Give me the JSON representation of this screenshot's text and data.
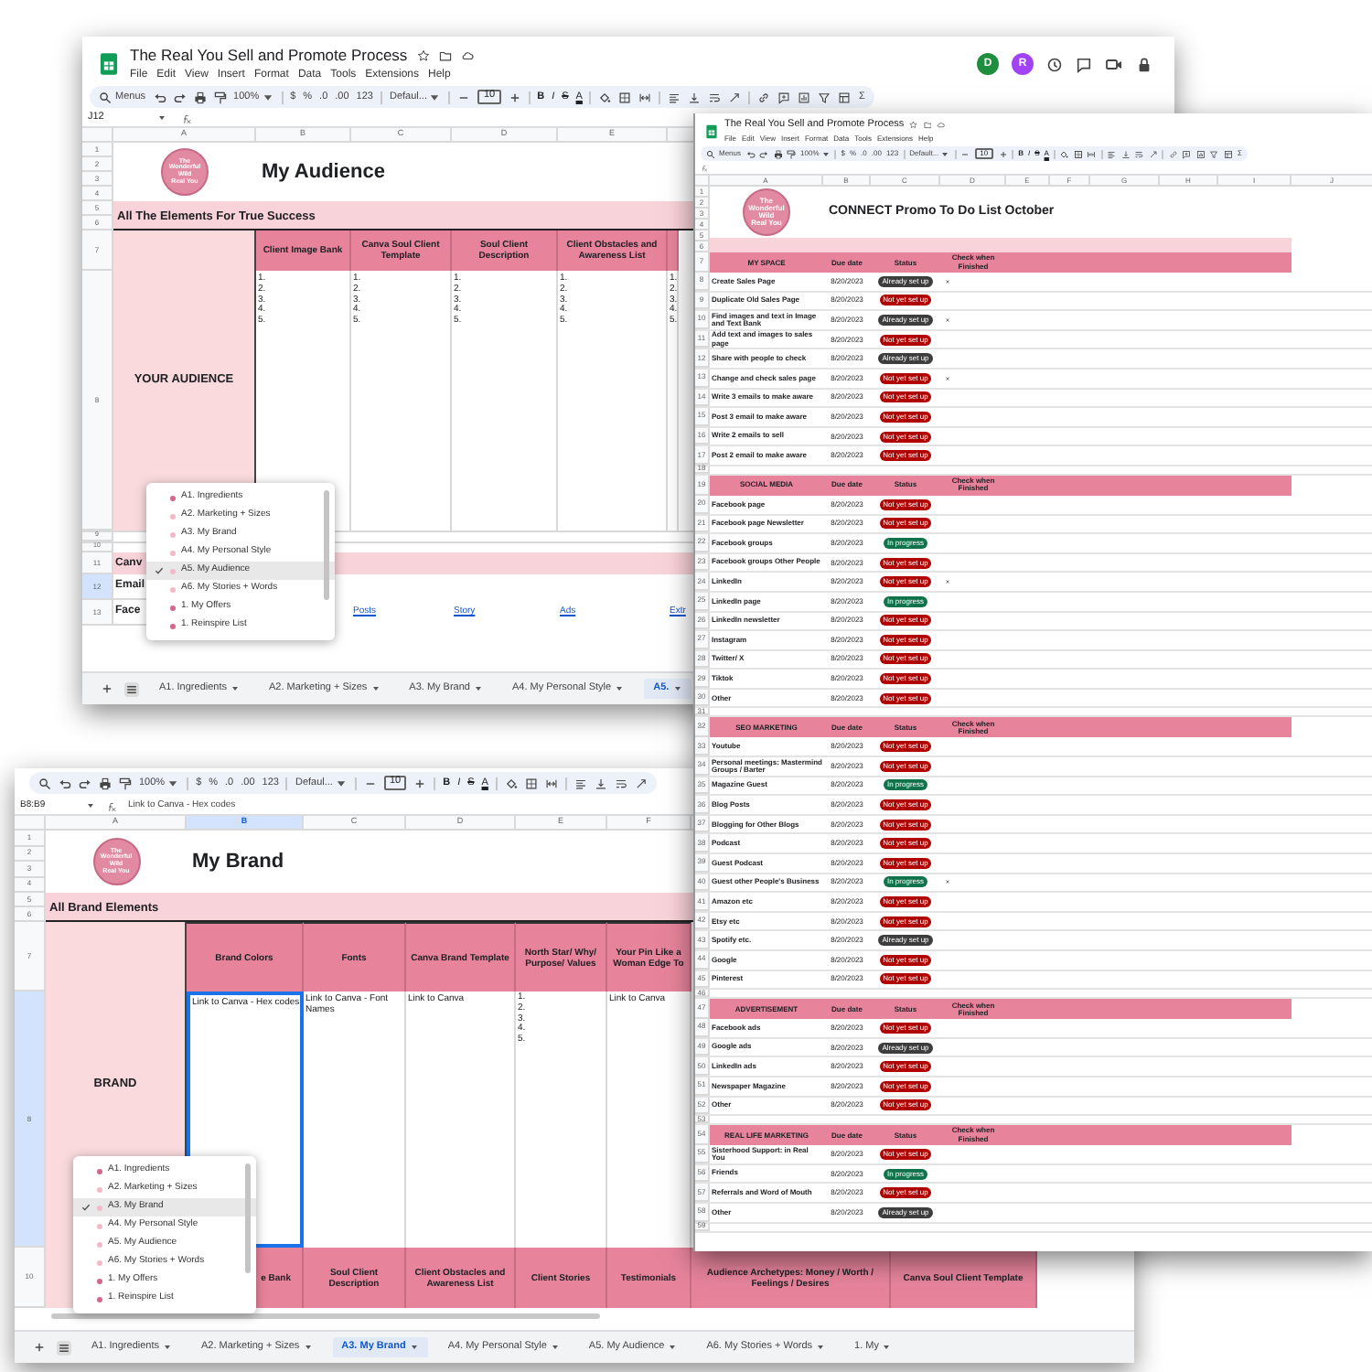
{
  "audience_window": {
    "title": "The Real You Sell and Promote Process",
    "menu": [
      "File",
      "Edit",
      "View",
      "Insert",
      "Format",
      "Data",
      "Tools",
      "Extensions",
      "Help"
    ],
    "avatars": [
      {
        "letter": "D",
        "color": "#1e8e3e"
      },
      {
        "letter": "R",
        "color": "#a142f4"
      }
    ],
    "toolbar": {
      "search": "Menus",
      "zoom": "100%",
      "currency": "$",
      "percent": "%",
      "decrease_decimals": ".0",
      "increase_decimals": ".00",
      "number_format": "123",
      "font": "Defaul...",
      "font_size": "10",
      "bold": "B",
      "italic": "I",
      "strikethrough": "S",
      "text_color": "A",
      "functions": "Σ"
    },
    "cell_ref": "J12",
    "column_letters": [
      "A",
      "B",
      "C",
      "D",
      "E"
    ],
    "top_rows": [
      "1",
      "2",
      "3",
      "4"
    ],
    "logo_lines": [
      "The",
      "Wonderful",
      "Wild",
      "Real You"
    ],
    "heading": "My Audience",
    "band_rows": [
      "5",
      "6"
    ],
    "section_title": "All The Elements For True Success",
    "header_row": "7",
    "body_row": "8",
    "group_label": "YOUR AUDIENCE",
    "columns": [
      {
        "header": "Client Image Bank",
        "items": [
          "1.",
          "2.",
          "3.",
          "4.",
          "5."
        ]
      },
      {
        "header": "Canva Soul Client Template",
        "items": [
          "1.",
          "2.",
          "3.",
          "4.",
          "5."
        ]
      },
      {
        "header": "Soul Client Description",
        "items": [
          "1.",
          "2.",
          "3.",
          "4.",
          "5."
        ]
      },
      {
        "header": "Client Obstacles and Awareness List",
        "items": [
          "1.",
          "2.",
          "3.",
          "4.",
          "5."
        ]
      },
      {
        "items": [
          "1.",
          "2.",
          "3.",
          "4.",
          "5."
        ]
      }
    ],
    "spacer_rows": [
      "9",
      "10"
    ],
    "lower_rows": [
      {
        "row": "11",
        "label": "Canv",
        "kind": "band",
        "selected": false
      },
      {
        "row": "12",
        "label": "Email",
        "kind": "plain",
        "selected": true
      },
      {
        "row": "13",
        "label": "Face",
        "kind": "links",
        "selected": false,
        "links": [
          "Posts",
          "Story",
          "Ads",
          "Extr"
        ]
      }
    ],
    "sheet_menu": [
      {
        "label": "A1. Ingredients",
        "color": "#d6668a",
        "selected": false
      },
      {
        "label": "A2. Marketing + Sizes",
        "color": "#f4b9c9",
        "selected": false
      },
      {
        "label": "A3. My Brand",
        "color": "#f4b9c9",
        "selected": false
      },
      {
        "label": "A4. My Personal Style",
        "color": "#f4b9c9",
        "selected": false
      },
      {
        "label": "A5. My Audience",
        "color": "#f4b9c9",
        "selected": true
      },
      {
        "label": "A6. My Stories + Words",
        "color": "#f4b9c9",
        "selected": false
      },
      {
        "label": "1. My Offers",
        "color": "#d6668a",
        "selected": false
      },
      {
        "label": "1. Reinspire List",
        "color": "#d6668a",
        "selected": false
      }
    ],
    "sheet_tabs": [
      {
        "label": "A1. Ingredients",
        "selected": false
      },
      {
        "label": "A2. Marketing + Sizes",
        "selected": false
      },
      {
        "label": "A3. My Brand",
        "selected": false
      },
      {
        "label": "A4. My Personal Style",
        "selected": false
      },
      {
        "label": "A5.",
        "selected": true
      }
    ]
  },
  "promo_window": {
    "title": "The Real You Sell and Promote Process",
    "menu": [
      "File",
      "Edit",
      "View",
      "Insert",
      "Format",
      "Data",
      "Tools",
      "Extensions",
      "Help"
    ],
    "toolbar": {
      "search": "Menus",
      "zoom": "100%",
      "currency": "$",
      "percent": "%",
      "decrease_decimals": ".0",
      "increase_decimals": ".00",
      "number_format": "123",
      "font": "Default...",
      "font_size": "10",
      "bold": "B",
      "italic": "I",
      "strikethrough": "S",
      "text_color": "A",
      "functions": "Σ"
    },
    "column_letters": [
      "A",
      "B",
      "C",
      "D",
      "E",
      "F",
      "G",
      "H",
      "I",
      "J"
    ],
    "top_rows": [
      "1",
      "2",
      "3",
      "4",
      "5",
      "6"
    ],
    "logo_lines": [
      "The",
      "Wonderful",
      "Wild",
      "Real You"
    ],
    "heading": "CONNECT Promo To Do List October",
    "sections": [
      {
        "row": "7",
        "name": "MY SPACE",
        "due": "Due date",
        "status": "Status",
        "check": "Check when Finished",
        "tasks": [
          {
            "row": "8",
            "task": "Create Sales Page",
            "date": "8/20/2023",
            "status": {
              "label": "Already set up",
              "kind": "done"
            },
            "checked": true
          },
          {
            "row": "9",
            "task": "Duplicate Old Sales Page",
            "date": "8/20/2023",
            "status": {
              "label": "Not yet set up",
              "kind": "todo"
            },
            "checked": false
          },
          {
            "row": "10",
            "task": "Find images and text in Image and Text Bank",
            "date": "8/20/2023",
            "status": {
              "label": "Already set up",
              "kind": "done"
            },
            "checked": true
          },
          {
            "row": "11",
            "task": "Add text and images to sales page",
            "date": "8/20/2023",
            "status": {
              "label": "Not yet set up",
              "kind": "todo"
            },
            "checked": false
          },
          {
            "row": "12",
            "task": "Share with people to check",
            "date": "8/20/2023",
            "status": {
              "label": "Already set up",
              "kind": "done"
            },
            "checked": false
          },
          {
            "row": "13",
            "task": "Change and check sales page",
            "date": "8/20/2023",
            "status": {
              "label": "Not yet set up",
              "kind": "todo"
            },
            "checked": true
          },
          {
            "row": "14",
            "task": "Write 3 emails to make aware",
            "date": "8/20/2023",
            "status": {
              "label": "Not yet set up",
              "kind": "todo"
            },
            "checked": false
          },
          {
            "row": "15",
            "task": "Post 3 email to make aware",
            "date": "8/20/2023",
            "status": {
              "label": "Not yet set up",
              "kind": "todo"
            },
            "checked": false
          },
          {
            "row": "16",
            "task": "Write 2 emails to sell",
            "date": "8/20/2023",
            "status": {
              "label": "Not yet set up",
              "kind": "todo"
            },
            "checked": false
          },
          {
            "row": "17",
            "task": "Post 2 email to make aware",
            "date": "8/20/2023",
            "status": {
              "label": "Not yet set up",
              "kind": "todo"
            },
            "checked": false
          }
        ],
        "gap_row": "18"
      },
      {
        "row": "19",
        "name": "SOCIAL MEDIA",
        "due": "Due date",
        "status": "Status",
        "check": "Check when Finished",
        "tasks": [
          {
            "row": "20",
            "task": "Facebook page",
            "date": "8/20/2023",
            "status": {
              "label": "Not yet set up",
              "kind": "todo"
            },
            "checked": false
          },
          {
            "row": "21",
            "task": "Facebook page Newsletter",
            "date": "8/20/2023",
            "status": {
              "label": "Not yet set up",
              "kind": "todo"
            },
            "checked": false
          },
          {
            "row": "22",
            "task": "Facebook groups",
            "date": "8/20/2023",
            "status": {
              "label": "In progress",
              "kind": "progress"
            },
            "checked": false
          },
          {
            "row": "23",
            "task": "Facebook groups Other People",
            "date": "8/20/2023",
            "status": {
              "label": "Not yet set up",
              "kind": "todo"
            },
            "checked": false
          },
          {
            "row": "24",
            "task": "LinkedIn",
            "date": "8/20/2023",
            "status": {
              "label": "Not yet set up",
              "kind": "todo"
            },
            "checked": true
          },
          {
            "row": "25",
            "task": "LinkedIn page",
            "date": "8/20/2023",
            "status": {
              "label": "In progress",
              "kind": "progress"
            },
            "checked": false
          },
          {
            "row": "26",
            "task": "LinkedIn newsletter",
            "date": "8/20/2023",
            "status": {
              "label": "Not yet set up",
              "kind": "todo"
            },
            "checked": false
          },
          {
            "row": "27",
            "task": "Instagram",
            "date": "8/20/2023",
            "status": {
              "label": "Not yet set up",
              "kind": "todo"
            },
            "checked": false
          },
          {
            "row": "28",
            "task": "Twitter/ X",
            "date": "8/20/2023",
            "status": {
              "label": "Not yet set up",
              "kind": "todo"
            },
            "checked": false
          },
          {
            "row": "29",
            "task": "Tiktok",
            "date": "8/20/2023",
            "status": {
              "label": "Not yet set up",
              "kind": "todo"
            },
            "checked": false
          },
          {
            "row": "30",
            "task": "Other",
            "date": "8/20/2023",
            "status": {
              "label": "Not yet set up",
              "kind": "todo"
            },
            "checked": false
          }
        ],
        "gap_row": "31"
      },
      {
        "row": "32",
        "name": "SEO MARKETING",
        "due": "Due date",
        "status": "Status",
        "check": "Check when Finished",
        "tasks": [
          {
            "row": "33",
            "task": "Youtube",
            "date": "8/20/2023",
            "status": {
              "label": "Not yet set up",
              "kind": "todo"
            },
            "checked": false
          },
          {
            "row": "34",
            "task": "Personal meetings: Mastermind Groups / Barter",
            "date": "8/20/2023",
            "status": {
              "label": "Not yet set up",
              "kind": "todo"
            },
            "checked": false
          },
          {
            "row": "35",
            "task": "Magazine Guest",
            "date": "8/20/2023",
            "status": {
              "label": "In progress",
              "kind": "progress"
            },
            "checked": false
          },
          {
            "row": "36",
            "task": "Blog Posts",
            "date": "8/20/2023",
            "status": {
              "label": "Not yet set up",
              "kind": "todo"
            },
            "checked": false
          },
          {
            "row": "37",
            "task": "Blogging for Other Blogs",
            "date": "8/20/2023",
            "status": {
              "label": "Not yet set up",
              "kind": "todo"
            },
            "checked": false
          },
          {
            "row": "38",
            "task": "Podcast",
            "date": "8/20/2023",
            "status": {
              "label": "Not yet set up",
              "kind": "todo"
            },
            "checked": false
          },
          {
            "row": "39",
            "task": "Guest Podcast",
            "date": "8/20/2023",
            "status": {
              "label": "Not yet set up",
              "kind": "todo"
            },
            "checked": false
          },
          {
            "row": "40",
            "task": "Guest other People's Business",
            "date": "8/20/2023",
            "status": {
              "label": "In progress",
              "kind": "progress"
            },
            "checked": true
          },
          {
            "row": "41",
            "task": "Amazon etc",
            "date": "8/20/2023",
            "status": {
              "label": "Not yet set up",
              "kind": "todo"
            },
            "checked": false
          },
          {
            "row": "42",
            "task": "Etsy etc",
            "date": "8/20/2023",
            "status": {
              "label": "Not yet set up",
              "kind": "todo"
            },
            "checked": false
          },
          {
            "row": "43",
            "task": "Spotify etc.",
            "date": "8/20/2023",
            "status": {
              "label": "Already set up",
              "kind": "done"
            },
            "checked": false
          },
          {
            "row": "44",
            "task": "Google",
            "date": "8/20/2023",
            "status": {
              "label": "Not yet set up",
              "kind": "todo"
            },
            "checked": false
          },
          {
            "row": "45",
            "task": "Pinterest",
            "date": "8/20/2023",
            "status": {
              "label": "Not yet set up",
              "kind": "todo"
            },
            "checked": false
          }
        ],
        "gap_row": "46"
      },
      {
        "row": "47",
        "name": "ADVERTISEMENT",
        "due": "Due date",
        "status": "Status",
        "check": "Check when Finished",
        "tasks": [
          {
            "row": "48",
            "task": "Facebook ads",
            "date": "8/20/2023",
            "status": {
              "label": "Not yet set up",
              "kind": "todo"
            },
            "checked": false
          },
          {
            "row": "49",
            "task": "Google ads",
            "date": "8/20/2023",
            "status": {
              "label": "Already set up",
              "kind": "done"
            },
            "checked": false
          },
          {
            "row": "50",
            "task": "LinkedIn ads",
            "date": "8/20/2023",
            "status": {
              "label": "Not yet set up",
              "kind": "todo"
            },
            "checked": false
          },
          {
            "row": "51",
            "task": "Newspaper Magazine",
            "date": "8/20/2023",
            "status": {
              "label": "Not yet set up",
              "kind": "todo"
            },
            "checked": false
          },
          {
            "row": "52",
            "task": "Other",
            "date": "8/20/2023",
            "status": {
              "label": "Not yet set up",
              "kind": "todo"
            },
            "checked": false
          }
        ],
        "gap_row": "53"
      },
      {
        "row": "54",
        "name": "REAL LIFE MARKETING",
        "due": "Due date",
        "status": "Status",
        "check": "Check when Finished",
        "tasks": [
          {
            "row": "55",
            "task": "Sisterhood Support: in Real You",
            "date": "8/20/2023",
            "status": {
              "label": "Not yet set up",
              "kind": "todo"
            },
            "checked": false
          },
          {
            "row": "56",
            "task": "Friends",
            "date": "8/20/2023",
            "status": {
              "label": "In progress",
              "kind": "progress"
            },
            "checked": false
          },
          {
            "row": "57",
            "task": "Referrals and Word of Mouth",
            "date": "8/20/2023",
            "status": {
              "label": "Not yet set up",
              "kind": "todo"
            },
            "checked": false
          },
          {
            "row": "58",
            "task": "Other",
            "date": "8/20/2023",
            "status": {
              "label": "Already set up",
              "kind": "done"
            },
            "checked": false
          }
        ],
        "gap_row": "59"
      }
    ]
  },
  "brand_window": {
    "toolbar": {
      "zoom": "100%",
      "currency": "$",
      "percent": "%",
      "decrease_decimals": ".0",
      "increase_decimals": ".00",
      "number_format": "123",
      "font": "Defaul...",
      "font_size": "10",
      "bold": "B",
      "italic": "I",
      "strikethrough": "S",
      "text_color": "A"
    },
    "cell_ref": "B8:B9",
    "formula": "Link to Canva - Hex codes",
    "column_letters": [
      {
        "letter": "A",
        "selected": false
      },
      {
        "letter": "B",
        "selected": true
      },
      {
        "letter": "C",
        "selected": false
      },
      {
        "letter": "D",
        "selected": false
      },
      {
        "letter": "E",
        "selected": false
      },
      {
        "letter": "F",
        "selected": false
      }
    ],
    "top_rows": [
      "1",
      "2",
      "3",
      "4"
    ],
    "logo_lines": [
      "The",
      "Wonderful",
      "Wild",
      "Real You"
    ],
    "heading": "My Brand",
    "band_rows": [
      "5",
      "6"
    ],
    "section_title": "All Brand Elements",
    "header_row": "7",
    "body_row": "8",
    "body_selected": true,
    "group_label": "BRAND",
    "columns": [
      {
        "header": "Brand Colors",
        "kind": "text",
        "text": "Link to Canva - Hex codes",
        "selected": true
      },
      {
        "header": "Fonts",
        "kind": "text",
        "text": "Link to Canva - Font Names",
        "selected": false
      },
      {
        "header": "Canva Brand Template",
        "kind": "text",
        "text": "Link to Canva",
        "selected": false
      },
      {
        "header": "North Star/ Why/ Purpose/ Values",
        "kind": "list",
        "items": [
          "1.",
          "2.",
          "3.",
          "4.",
          "5."
        ],
        "selected": false
      },
      {
        "header": "Your Pin Like a Woman Edge To",
        "kind": "text",
        "text": "Link to Canva",
        "selected": false
      }
    ],
    "lower_row": "10",
    "lower_headers": [
      "e Bank",
      "Soul Client Description",
      "Client Obstacles and Awareness List",
      "Client Stories",
      "Testimonials",
      "Audience Archetypes: Money / Worth / Feelings / Desires",
      "Canva Soul Client Template"
    ],
    "sheet_menu": [
      {
        "label": "A1. Ingredients",
        "color": "#d6668a",
        "selected": false
      },
      {
        "label": "A2. Marketing + Sizes",
        "color": "#f4b9c9",
        "selected": false
      },
      {
        "label": "A3. My Brand",
        "color": "#f4b9c9",
        "selected": true
      },
      {
        "label": "A4. My Personal Style",
        "color": "#f4b9c9",
        "selected": false
      },
      {
        "label": "A5. My Audience",
        "color": "#f4b9c9",
        "selected": false
      },
      {
        "label": "A6. My Stories + Words",
        "color": "#f4b9c9",
        "selected": false
      },
      {
        "label": "1. My Offers",
        "color": "#d6668a",
        "selected": false
      },
      {
        "label": "1. Reinspire List",
        "color": "#d6668a",
        "selected": false
      }
    ],
    "sheet_tabs": [
      {
        "label": "A1. Ingredients",
        "selected": false
      },
      {
        "label": "A2. Marketing + Sizes",
        "selected": false
      },
      {
        "label": "A3. My Brand",
        "selected": true
      },
      {
        "label": "A4. My Personal Style",
        "selected": false
      },
      {
        "label": "A5. My Audience",
        "selected": false
      },
      {
        "label": "A6. My Stories + Words",
        "selected": false
      },
      {
        "label": "1. My",
        "selected": false
      }
    ]
  }
}
